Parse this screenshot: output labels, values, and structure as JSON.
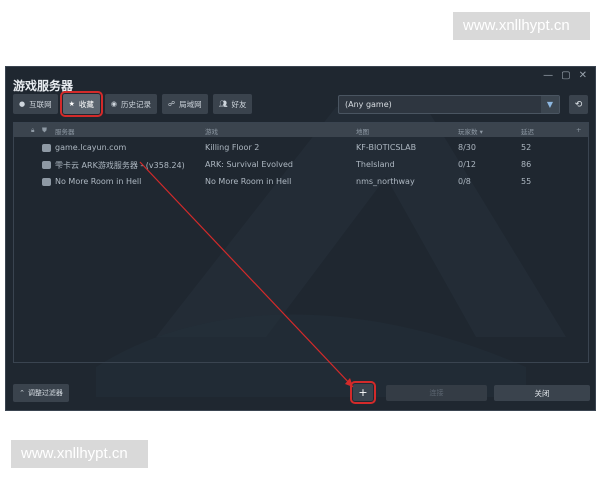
{
  "watermark": {
    "top": "www.xnllhypt.cn",
    "bottom": "www.xnllhypt.cn"
  },
  "window": {
    "title": "游戏服务器",
    "controls": [
      "—",
      "▢",
      "✕"
    ]
  },
  "tabs": [
    {
      "label": "互联网",
      "icon": "circle-icon"
    },
    {
      "label": "收藏",
      "icon": "star-icon"
    },
    {
      "label": "历史记录",
      "icon": "history-icon"
    },
    {
      "label": "局域网",
      "icon": "lan-icon"
    },
    {
      "label": "好友",
      "icon": "friends-icon"
    }
  ],
  "game_filter": {
    "value": "(Any game)"
  },
  "table": {
    "headers": {
      "name": "服务器",
      "game": "游戏",
      "map": "地图",
      "players": "玩家数 ▾",
      "ping": "延迟",
      "add": "+"
    },
    "rows": [
      {
        "name": "game.lcayun.com",
        "game": "Killing Floor 2",
        "map": "KF-BIOTICSLAB",
        "players": "8/30",
        "ping": "52"
      },
      {
        "name": "雫卡云 ARK游戏服务器 - (v358.24)",
        "game": "ARK: Survival Evolved",
        "map": "TheIsland",
        "players": "0/12",
        "ping": "86"
      },
      {
        "name": "No More Room in Hell",
        "game": "No More Room in Hell",
        "map": "nms_northway",
        "players": "0/8",
        "ping": "55"
      }
    ]
  },
  "bottom": {
    "filter_label": "调整过滤器",
    "add_label": "+",
    "connect_label": "连接",
    "close_label": "关闭"
  },
  "colors": {
    "highlight": "#d32a2a",
    "window_bg": "#1f2730"
  }
}
